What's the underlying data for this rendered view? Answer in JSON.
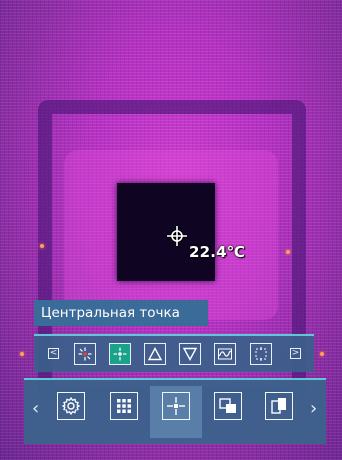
{
  "overlay": {
    "temperature": "22.4℃",
    "tooltip": "Центральная точка"
  },
  "sub_toolbar": {
    "left_arrow": "<",
    "right_arrow": ">",
    "items": [
      {
        "icon": "point-burst-icon",
        "active": false
      },
      {
        "icon": "center-point-icon",
        "active": true
      },
      {
        "icon": "triangle-up-icon",
        "active": false
      },
      {
        "icon": "triangle-down-icon",
        "active": false
      },
      {
        "icon": "waveform-icon",
        "active": false
      },
      {
        "icon": "area-select-icon",
        "active": false
      }
    ]
  },
  "main_toolbar": {
    "left_chevron": "‹",
    "right_chevron": "›",
    "items": [
      {
        "icon": "settings-gear-icon",
        "active": false
      },
      {
        "icon": "grid-icon",
        "active": false
      },
      {
        "icon": "center-measure-icon",
        "active": true
      },
      {
        "icon": "picture-in-picture-icon",
        "active": false
      },
      {
        "icon": "dual-view-icon",
        "active": false
      }
    ]
  },
  "colors": {
    "toolbar_bg": "#3c628c",
    "accent_border": "#63c5d8",
    "active_item": "#1aa28a",
    "tooltip_bg": "#3b6b98"
  }
}
